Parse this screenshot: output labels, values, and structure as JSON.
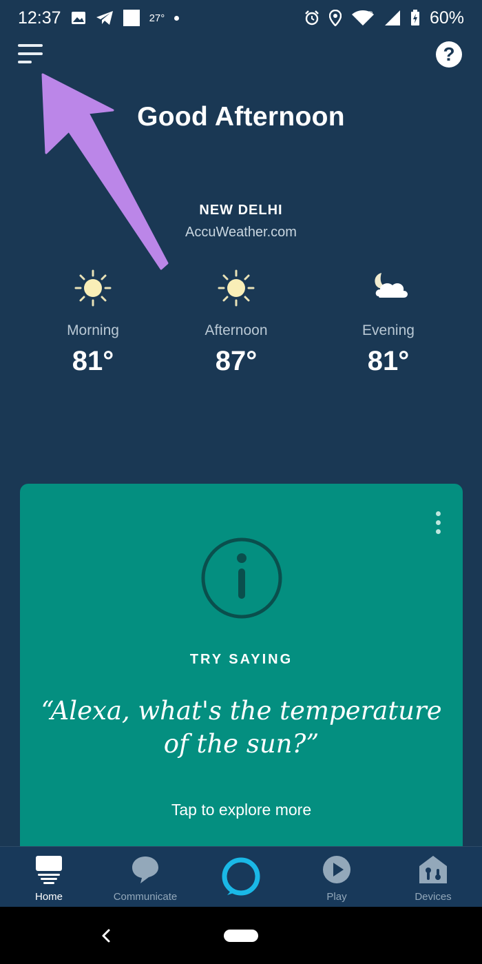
{
  "status_bar": {
    "time": "12:37",
    "weather_temp": "27°",
    "battery": "60%",
    "icons": [
      "image-icon",
      "telegram-icon",
      "square-notification-icon",
      "dot-icon",
      "alarm-icon",
      "location-icon",
      "wifi-icon",
      "battery-icon"
    ]
  },
  "header": {
    "menu_icon": "hamburger-menu-icon",
    "help_label": "?"
  },
  "greeting": "Good Afternoon",
  "weather": {
    "city": "NEW DELHI",
    "source": "AccuWeather.com",
    "forecast": [
      {
        "label": "Morning",
        "temp": "81°",
        "icon": "sun-icon"
      },
      {
        "label": "Afternoon",
        "temp": "87°",
        "icon": "sun-icon"
      },
      {
        "label": "Evening",
        "temp": "81°",
        "icon": "moon-cloud-icon"
      }
    ]
  },
  "card": {
    "icon": "info-icon",
    "heading": "TRY SAYING",
    "quote": "“Alexa, what's the temperature of the sun?”",
    "link": "Tap to explore more"
  },
  "bottom_nav": {
    "items": [
      {
        "label": "Home",
        "icon": "home-icon",
        "active": true
      },
      {
        "label": "Communicate",
        "icon": "chat-bubble-icon",
        "active": false
      },
      {
        "label": "",
        "icon": "alexa-ring-icon",
        "active": false
      },
      {
        "label": "Play",
        "icon": "play-icon",
        "active": false
      },
      {
        "label": "Devices",
        "icon": "devices-icon",
        "active": false
      }
    ]
  },
  "colors": {
    "background": "#1a3854",
    "card": "#048f80",
    "alexa_accent": "#1ab8e6",
    "annotation_arrow": "#bb86e8"
  }
}
